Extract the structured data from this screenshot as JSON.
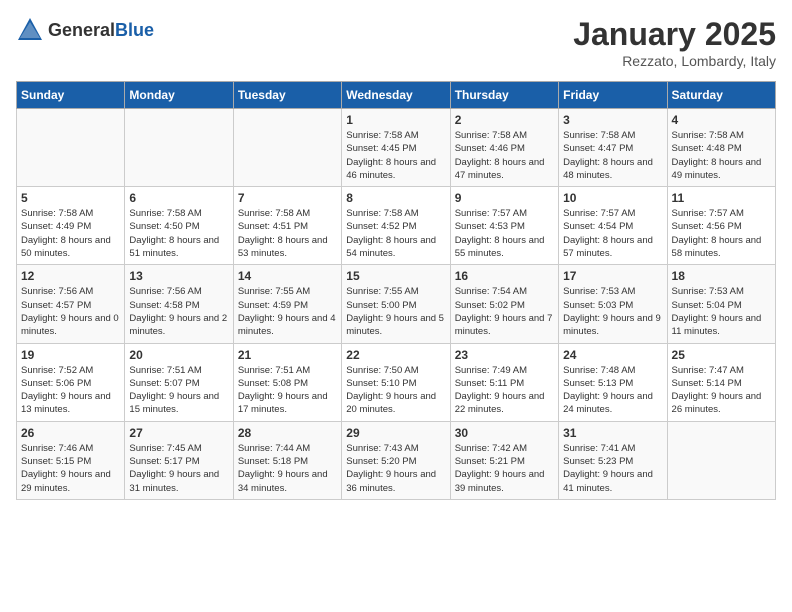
{
  "header": {
    "logo_general": "General",
    "logo_blue": "Blue",
    "month_title": "January 2025",
    "subtitle": "Rezzato, Lombardy, Italy"
  },
  "weekdays": [
    "Sunday",
    "Monday",
    "Tuesday",
    "Wednesday",
    "Thursday",
    "Friday",
    "Saturday"
  ],
  "weeks": [
    [
      {
        "day": "",
        "info": ""
      },
      {
        "day": "",
        "info": ""
      },
      {
        "day": "",
        "info": ""
      },
      {
        "day": "1",
        "info": "Sunrise: 7:58 AM\nSunset: 4:45 PM\nDaylight: 8 hours and 46 minutes."
      },
      {
        "day": "2",
        "info": "Sunrise: 7:58 AM\nSunset: 4:46 PM\nDaylight: 8 hours and 47 minutes."
      },
      {
        "day": "3",
        "info": "Sunrise: 7:58 AM\nSunset: 4:47 PM\nDaylight: 8 hours and 48 minutes."
      },
      {
        "day": "4",
        "info": "Sunrise: 7:58 AM\nSunset: 4:48 PM\nDaylight: 8 hours and 49 minutes."
      }
    ],
    [
      {
        "day": "5",
        "info": "Sunrise: 7:58 AM\nSunset: 4:49 PM\nDaylight: 8 hours and 50 minutes."
      },
      {
        "day": "6",
        "info": "Sunrise: 7:58 AM\nSunset: 4:50 PM\nDaylight: 8 hours and 51 minutes."
      },
      {
        "day": "7",
        "info": "Sunrise: 7:58 AM\nSunset: 4:51 PM\nDaylight: 8 hours and 53 minutes."
      },
      {
        "day": "8",
        "info": "Sunrise: 7:58 AM\nSunset: 4:52 PM\nDaylight: 8 hours and 54 minutes."
      },
      {
        "day": "9",
        "info": "Sunrise: 7:57 AM\nSunset: 4:53 PM\nDaylight: 8 hours and 55 minutes."
      },
      {
        "day": "10",
        "info": "Sunrise: 7:57 AM\nSunset: 4:54 PM\nDaylight: 8 hours and 57 minutes."
      },
      {
        "day": "11",
        "info": "Sunrise: 7:57 AM\nSunset: 4:56 PM\nDaylight: 8 hours and 58 minutes."
      }
    ],
    [
      {
        "day": "12",
        "info": "Sunrise: 7:56 AM\nSunset: 4:57 PM\nDaylight: 9 hours and 0 minutes."
      },
      {
        "day": "13",
        "info": "Sunrise: 7:56 AM\nSunset: 4:58 PM\nDaylight: 9 hours and 2 minutes."
      },
      {
        "day": "14",
        "info": "Sunrise: 7:55 AM\nSunset: 4:59 PM\nDaylight: 9 hours and 4 minutes."
      },
      {
        "day": "15",
        "info": "Sunrise: 7:55 AM\nSunset: 5:00 PM\nDaylight: 9 hours and 5 minutes."
      },
      {
        "day": "16",
        "info": "Sunrise: 7:54 AM\nSunset: 5:02 PM\nDaylight: 9 hours and 7 minutes."
      },
      {
        "day": "17",
        "info": "Sunrise: 7:53 AM\nSunset: 5:03 PM\nDaylight: 9 hours and 9 minutes."
      },
      {
        "day": "18",
        "info": "Sunrise: 7:53 AM\nSunset: 5:04 PM\nDaylight: 9 hours and 11 minutes."
      }
    ],
    [
      {
        "day": "19",
        "info": "Sunrise: 7:52 AM\nSunset: 5:06 PM\nDaylight: 9 hours and 13 minutes."
      },
      {
        "day": "20",
        "info": "Sunrise: 7:51 AM\nSunset: 5:07 PM\nDaylight: 9 hours and 15 minutes."
      },
      {
        "day": "21",
        "info": "Sunrise: 7:51 AM\nSunset: 5:08 PM\nDaylight: 9 hours and 17 minutes."
      },
      {
        "day": "22",
        "info": "Sunrise: 7:50 AM\nSunset: 5:10 PM\nDaylight: 9 hours and 20 minutes."
      },
      {
        "day": "23",
        "info": "Sunrise: 7:49 AM\nSunset: 5:11 PM\nDaylight: 9 hours and 22 minutes."
      },
      {
        "day": "24",
        "info": "Sunrise: 7:48 AM\nSunset: 5:13 PM\nDaylight: 9 hours and 24 minutes."
      },
      {
        "day": "25",
        "info": "Sunrise: 7:47 AM\nSunset: 5:14 PM\nDaylight: 9 hours and 26 minutes."
      }
    ],
    [
      {
        "day": "26",
        "info": "Sunrise: 7:46 AM\nSunset: 5:15 PM\nDaylight: 9 hours and 29 minutes."
      },
      {
        "day": "27",
        "info": "Sunrise: 7:45 AM\nSunset: 5:17 PM\nDaylight: 9 hours and 31 minutes."
      },
      {
        "day": "28",
        "info": "Sunrise: 7:44 AM\nSunset: 5:18 PM\nDaylight: 9 hours and 34 minutes."
      },
      {
        "day": "29",
        "info": "Sunrise: 7:43 AM\nSunset: 5:20 PM\nDaylight: 9 hours and 36 minutes."
      },
      {
        "day": "30",
        "info": "Sunrise: 7:42 AM\nSunset: 5:21 PM\nDaylight: 9 hours and 39 minutes."
      },
      {
        "day": "31",
        "info": "Sunrise: 7:41 AM\nSunset: 5:23 PM\nDaylight: 9 hours and 41 minutes."
      },
      {
        "day": "",
        "info": ""
      }
    ]
  ]
}
